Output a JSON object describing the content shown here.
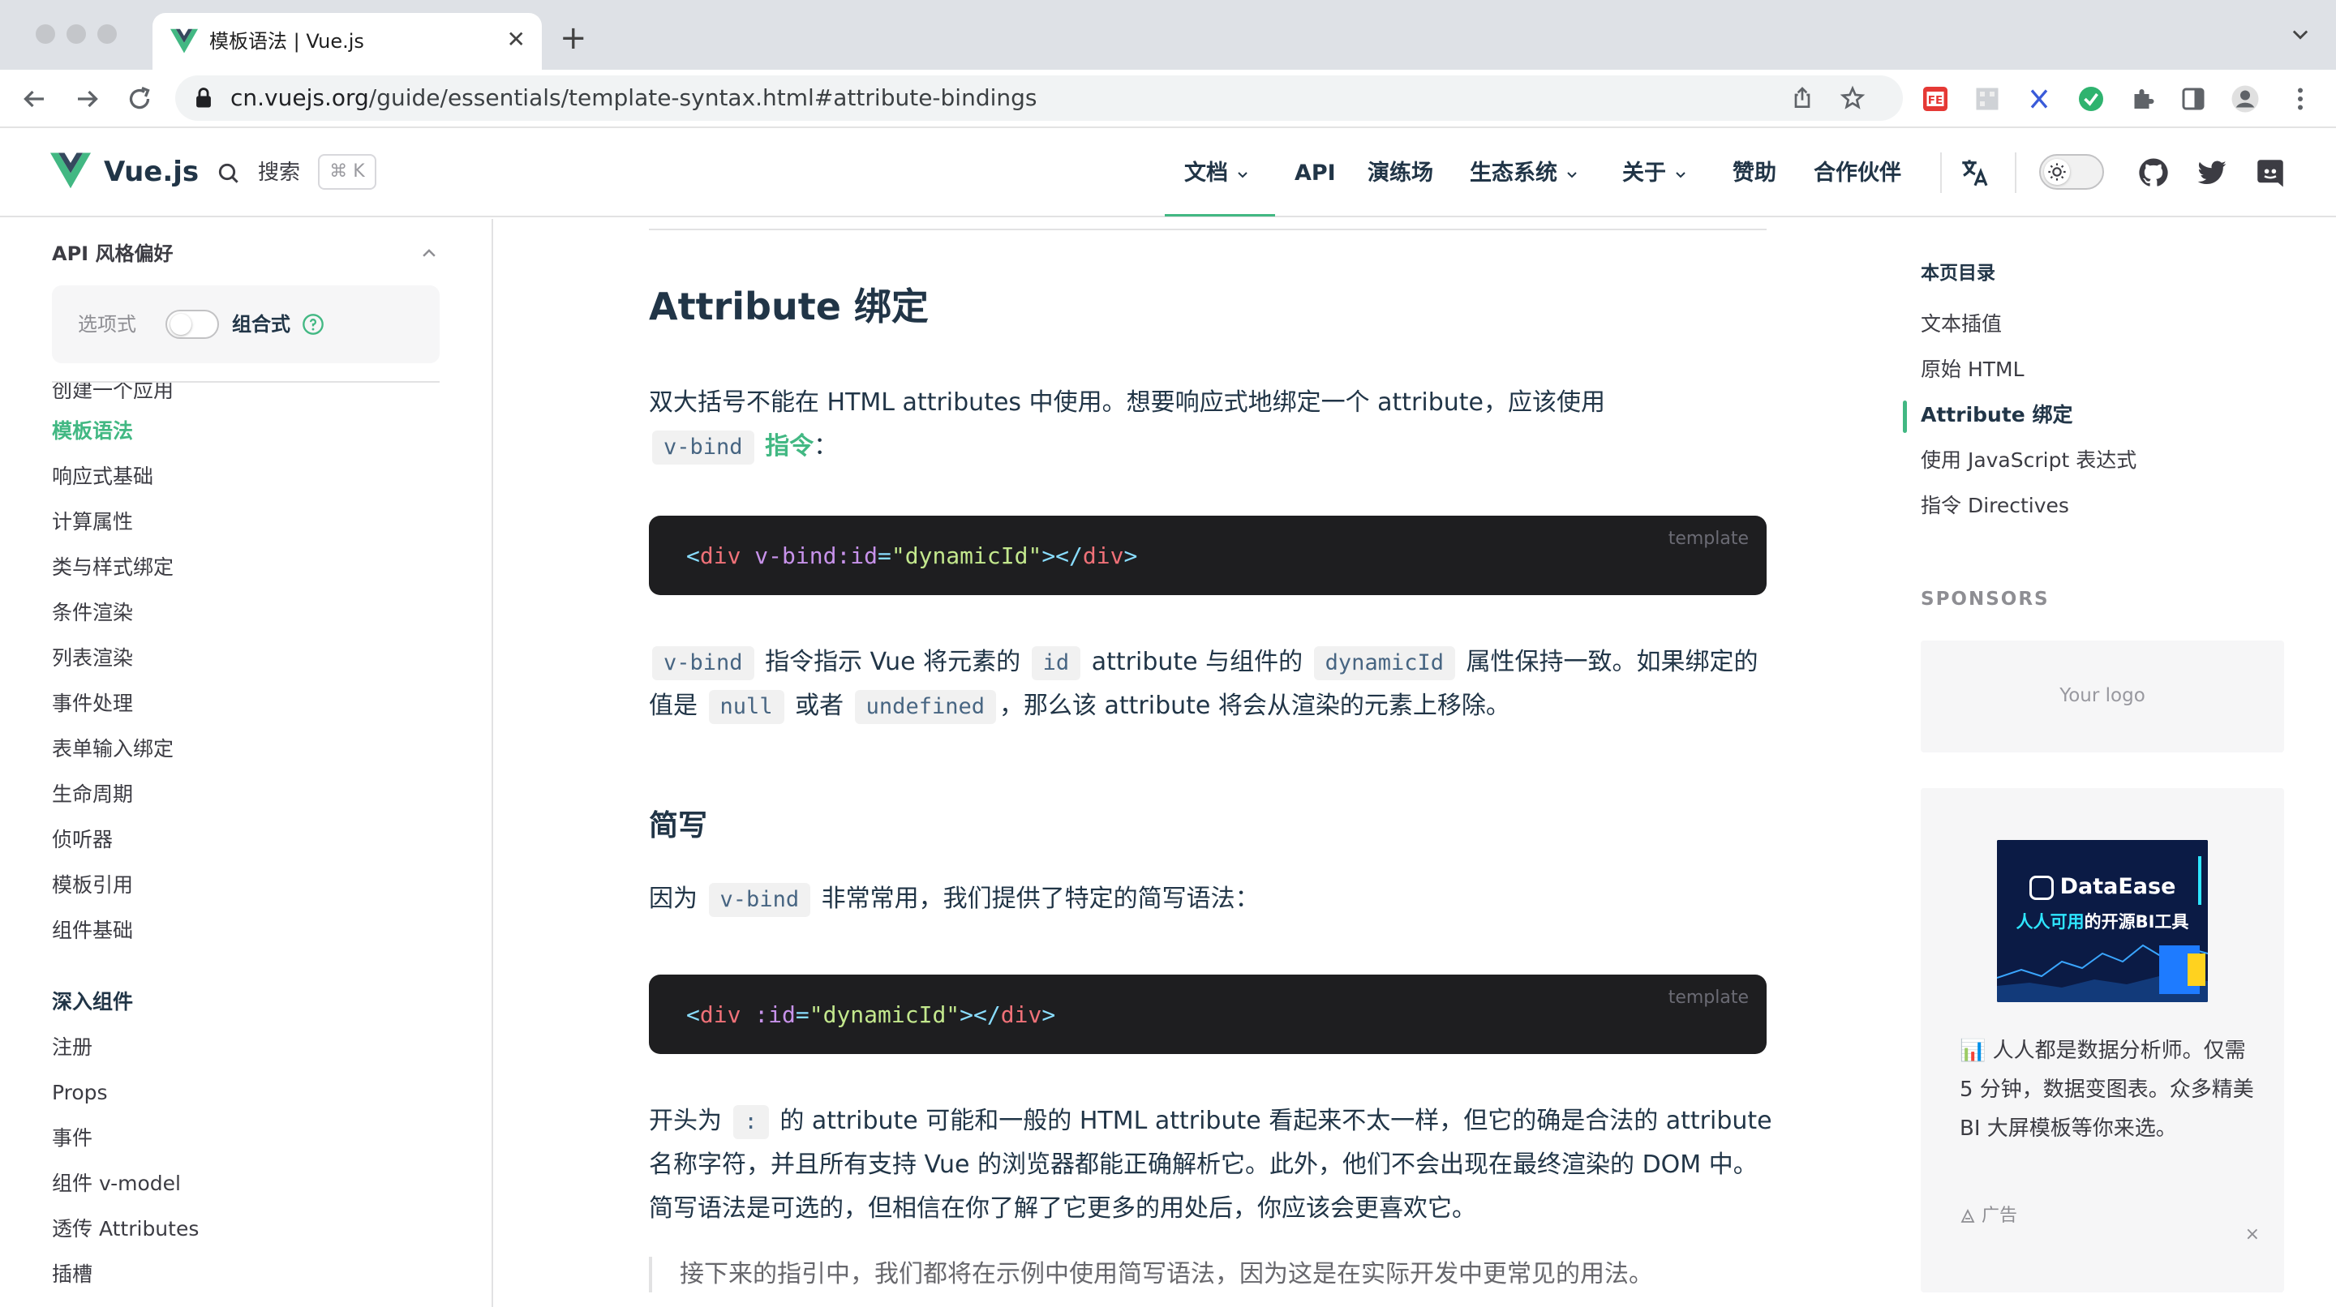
{
  "browser": {
    "tab_title": "模板语法 | Vue.js",
    "url_host": "cn.vuejs.org",
    "url_path": "/guide/essentials/template-syntax.html#attribute-bindings"
  },
  "header": {
    "brand": "Vue.js",
    "search_label": "搜索",
    "search_kbd": "⌘ K",
    "nav": [
      "文档",
      "API",
      "演练场",
      "生态系统",
      "关于",
      "赞助",
      "合作伙伴"
    ]
  },
  "sidebar": {
    "pref_title": "API 风格偏好",
    "pref_option": "选项式",
    "pref_composition": "组合式",
    "partial_item": "创建一个应用",
    "items": [
      "模板语法",
      "响应式基础",
      "计算属性",
      "类与样式绑定",
      "条件渲染",
      "列表渲染",
      "事件处理",
      "表单输入绑定",
      "生命周期",
      "侦听器",
      "模板引用",
      "组件基础"
    ],
    "group2_title": "深入组件",
    "group2_items": [
      "注册",
      "Props",
      "事件",
      "组件 v-model",
      "透传 Attributes",
      "插槽"
    ]
  },
  "content": {
    "h2": "Attribute 绑定",
    "p1_text": "双大括号不能在 HTML attributes 中使用。想要响应式地绑定一个 attribute，应该使用",
    "p1_code": "v-bind",
    "p1_link": "指令",
    "p1_end": "：",
    "code1_lang": "template",
    "code1": {
      "open_lt": "<",
      "tag": "div",
      "attr": "v-bind:id",
      "eq": "=",
      "str": "\"dynamicId\"",
      "close": "></",
      "tag2": "div",
      "gt": ">"
    },
    "p2": {
      "c1": "v-bind",
      "t1": "指令指示 Vue 将元素的",
      "c2": "id",
      "t2": "attribute 与组件的",
      "c3": "dynamicId",
      "t3": "属性保持一致。如果绑定的值是",
      "c4": "null",
      "t4": "或者",
      "c5": "undefined",
      "t5": "，那么该 attribute 将会从渲染的元素上移除。"
    },
    "h3": "简写",
    "p3": {
      "t1": "因为",
      "c1": "v-bind",
      "t2": "非常常用，我们提供了特定的简写语法："
    },
    "code2_lang": "template",
    "code2": {
      "open_lt": "<",
      "tag": "div",
      "attr": ":id",
      "eq": "=",
      "str": "\"dynamicId\"",
      "close": "></",
      "tag2": "div",
      "gt": ">"
    },
    "p4": {
      "t1": "开头为",
      "c1": ":",
      "t2": "的 attribute 可能和一般的 HTML attribute 看起来不太一样，但它的确是合法的 attribute 名称字符，并且所有支持 Vue 的浏览器都能正确解析它。此外，他们不会出现在最终渲染的 DOM 中。简写语法是可选的，但相信在你了解了它更多的用处后，你应该会更喜欢它。"
    },
    "quote": "接下来的指引中，我们都将在示例中使用简写语法，因为这是在实际开发中更常见的用法。"
  },
  "aside": {
    "toc_title": "本页目录",
    "toc": [
      "文本插值",
      "原始 HTML",
      "Attribute 绑定",
      "使用 JavaScript 表达式",
      "指令 Directives"
    ],
    "toc_active_index": 2,
    "sponsors_title": "SPONSORS",
    "logo_placeholder": "Your logo",
    "ad_brand": "DataEase",
    "ad_tag_cyan": "人人可用",
    "ad_tag_rest": "的开源BI工具",
    "ad_text": "📊 人人都是数据分析师。仅需 5 分钟，数据变图表。众多精美 BI 大屏模板等你来选。",
    "ad_label": "广告",
    "ad_close": "×"
  },
  "colors": {
    "accent": "#42b883",
    "text": "#213547",
    "code_bg": "#1e1e20"
  }
}
